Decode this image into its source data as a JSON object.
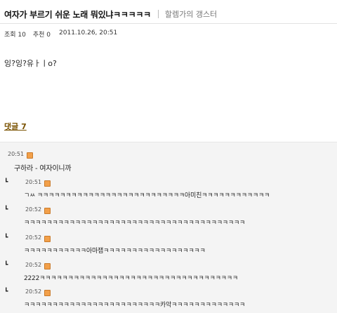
{
  "post": {
    "title": "여자가 부르기 쉬운 노래 뭐있냐ㅋㅋㅋㅋㅋ",
    "gallery": "할렘가의 갱스터",
    "views": "조회 10",
    "recommend": "추천 0",
    "date": "2011.10.26, 20:51",
    "body": "잉?잉?유ㅏㅣo?"
  },
  "comments_link": "댓글 7",
  "comments": [
    {
      "time": "20:51",
      "text": "구하라 - 여자이니까",
      "reply": false
    },
    {
      "time": "20:51",
      "text": "ㄱㅆ ㅋㅋㅋㅋㅋㅋㅋㅋㅋㅋㅋㅋㅋㅋㅋㅋㅋㅋㅋㅋㅋㅋㅋㅋㅋㅋ아미친ㅋㅋㅋㅋㅋㅋㅋㅋㅋㅋㅋㅋ",
      "reply": true
    },
    {
      "time": "20:52",
      "text": "ㅋㅋㅋㅋㅋㅋㅋㅋㅋㅋㅋㅋㅋㅋㅋㅋㅋㅋㅋㅋㅋㅋㅋㅋㅋㅋㅋㅋㅋㅋㅋㅋㅋㅋㅋㅋㅋㅋㅋ",
      "reply": true
    },
    {
      "time": "20:52",
      "text": "ㅋㅋㅋㅋㅋㅋㅋㅋㅋㅋㅋ아마잽ㅋㅋㅋㅋㅋㅋㅋㅋㅋㅋㅋㅋㅋㅋㅋㅋㅋㅋ",
      "reply": true
    },
    {
      "time": "20:52",
      "text": "2222ㅋㅋㅋㅋㅋㅋㅋㅋㅋㅋㅋㅋㅋㅋㅋㅋㅋㅋㅋㅋㅋㅋㅋㅋㅋㅋㅋㅋㅋㅋㅋㅋㅋㅋㅋ",
      "reply": true
    },
    {
      "time": "20:52",
      "text": "ㅋㅋㅋㅋㅋㅋㅋㅋㅋㅋㅋㅋㅋㅋㅋㅋㅋㅋㅋㅋㅋㅋㅋㅋ카악ㅋㅋㅋㅋㅋㅋㅋㅋㅋㅋㅋㅋㅋ",
      "reply": true
    }
  ],
  "icons": {
    "comment_user": "gallog-user-icon",
    "reply": "reply-arrow-icon"
  },
  "colors": {
    "user_icon": "#f2a04a",
    "comment_link": "#7a5200",
    "comment_bg": "#f4f4f4"
  }
}
